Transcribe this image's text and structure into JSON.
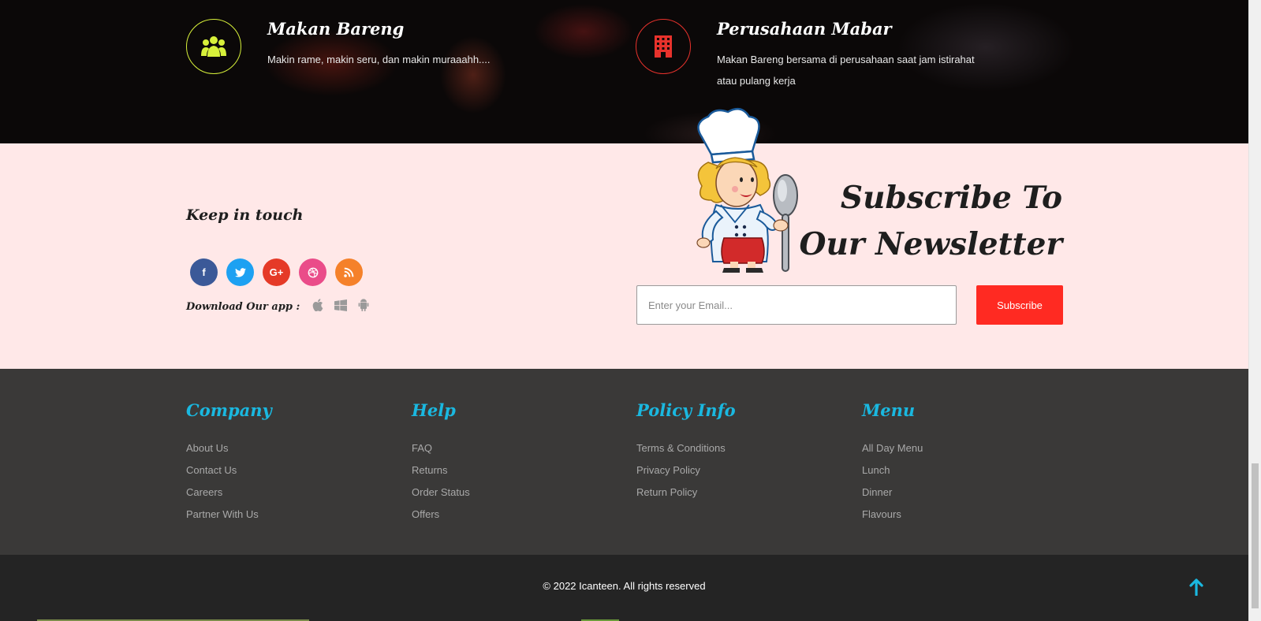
{
  "hero": {
    "features": [
      {
        "icon": "users-icon",
        "title": "Makan Bareng",
        "description": "Makin rame, makin seru, dan makin muraaahh....",
        "color": "#d7f03a"
      },
      {
        "icon": "building-icon",
        "title": "Perusahaan Mabar",
        "description": "Makan Bareng bersama di perusahaan saat jam istirahat atau pulang kerja",
        "color": "#e8322c"
      }
    ]
  },
  "newsletter": {
    "keep_in_touch": "Keep in touch",
    "socials": [
      {
        "icon": "facebook-icon",
        "glyph": "f",
        "color": "#3b5998"
      },
      {
        "icon": "twitter-icon",
        "glyph": "🐦",
        "color": "#1da1f2"
      },
      {
        "icon": "google-plus-icon",
        "glyph": "G+",
        "color": "#e53a27"
      },
      {
        "icon": "dribbble-icon",
        "glyph": "◎",
        "color": "#ea4c89"
      },
      {
        "icon": "rss-icon",
        "glyph": "◝",
        "color": "#f5812a"
      }
    ],
    "download_label": "Download Our app :",
    "app_icons": [
      "apple-icon",
      "windows-icon",
      "android-icon"
    ],
    "title": "Subscribe To Our Newsletter",
    "email_placeholder": "Enter your Email...",
    "subscribe_label": "Subscribe"
  },
  "footer": {
    "columns": [
      {
        "heading": "Company",
        "links": [
          "About Us",
          "Contact Us",
          "Careers",
          "Partner With Us"
        ]
      },
      {
        "heading": "Help",
        "links": [
          "FAQ",
          "Returns",
          "Order Status",
          "Offers"
        ]
      },
      {
        "heading": "Policy Info",
        "links": [
          "Terms & Conditions",
          "Privacy Policy",
          "Return Policy"
        ]
      },
      {
        "heading": "Menu",
        "links": [
          "All Day Menu",
          "Lunch",
          "Dinner",
          "Flavours"
        ]
      }
    ],
    "copyright": "© 2022 Icanteen. All rights reserved",
    "accent_color": "#1ab8e0"
  }
}
